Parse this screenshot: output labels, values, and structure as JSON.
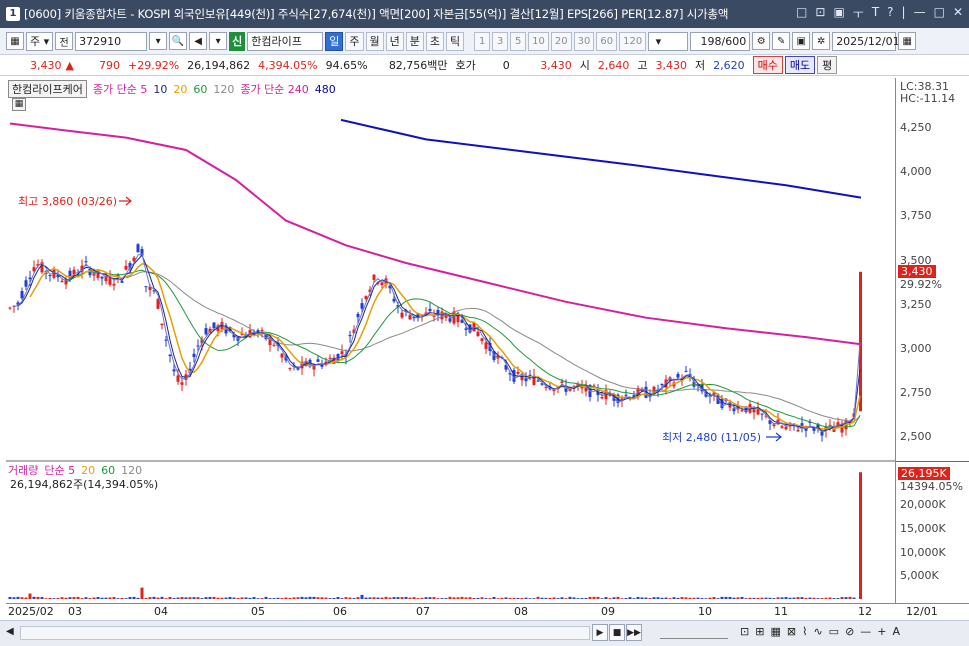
{
  "window": {
    "id": "1",
    "title": "[0600] 키움종합차트 - KOSPI 외국인보유[449(천)] 주식수[27,674(천)] 액면[200] 자본금[55(억)] 결산[12월] EPS[266] PER[12.87] 시가총액",
    "controls": [
      "□",
      "⊡",
      "▣",
      "ㅜ",
      "T",
      "?",
      "|",
      "—",
      "□",
      "✕"
    ]
  },
  "toolbar": {
    "market": "주",
    "market2": "전",
    "code": "372910",
    "badge": "신",
    "stock_name": "한컴라이프",
    "periods": [
      "일",
      "주",
      "월",
      "년",
      "분",
      "초",
      "틱"
    ],
    "active_period": "일",
    "intervals": [
      "1",
      "3",
      "5",
      "10",
      "20",
      "30",
      "60",
      "120"
    ],
    "count": "198",
    "count_total": "/600",
    "date": "2025/12/01"
  },
  "quote": {
    "price": "3,430",
    "change": "790",
    "change_pct": "+29.92%",
    "volume": "26,194,862",
    "vol_ratio": "4,394.05%",
    "pct2": "94.65%",
    "amount": "82,756백만",
    "bid_label": "호가",
    "bid": "0",
    "bid_price": "3,430",
    "open_label": "시",
    "open": "2,640",
    "high_label": "고",
    "high": "3,430",
    "low_label": "저",
    "low": "2,620",
    "buy": "매수",
    "sell": "매도",
    "eval": "평"
  },
  "legend_price": {
    "name": "한컴라이프케어",
    "ma_label": "종가 단순 5",
    "ma": [
      "10",
      "20",
      "60",
      "120"
    ],
    "ma2_label": "종가 단순 240",
    "ma2": "480"
  },
  "legend_volume": {
    "name": "거래량",
    "ma_label": "단순 5",
    "ma": [
      "20",
      "60",
      "120"
    ],
    "value": "26,194,862주(14,394.05%)"
  },
  "annotations": {
    "high": "최고 3,860 (03/26)",
    "low": "최저 2,480 (11/05)"
  },
  "price_axis": {
    "lc": "LC:38.31",
    "hc": "HC:-11.14",
    "ticks": [
      "4,250",
      "4,000",
      "3,750",
      "3,500",
      "3,250",
      "3,000",
      "2,750",
      "2,500"
    ],
    "current": "3,430",
    "current_pct": "29.92%"
  },
  "volume_axis": {
    "current": "26,195K",
    "current_pct": "14394.05%",
    "ticks": [
      "20,000K",
      "15,000K",
      "10,000K",
      "5,000K"
    ]
  },
  "x_axis": [
    "2025/02",
    "03",
    "04",
    "05",
    "06",
    "07",
    "08",
    "09",
    "10",
    "11",
    "12",
    "12/01"
  ],
  "colors": {
    "up": "#e0231a",
    "down": "#1f3fd4",
    "ma5": "#7070d0",
    "ma10": "#1a2a88",
    "ma20": "#e8a000",
    "ma60": "#1e9a3a",
    "ma120": "#8a8a8a",
    "ma240": "#d4209c",
    "ma480": "#1010c0"
  }
}
